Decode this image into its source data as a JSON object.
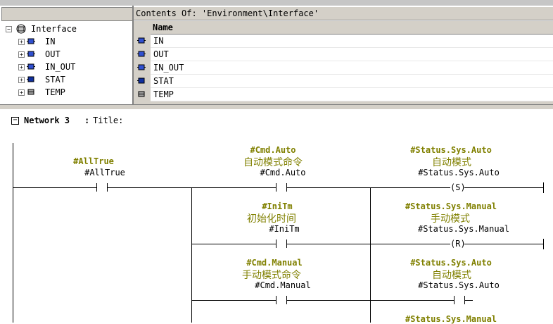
{
  "tree": {
    "root_label": "Interface",
    "items": [
      {
        "label": "IN"
      },
      {
        "label": "OUT"
      },
      {
        "label": "IN_OUT"
      },
      {
        "label": "STAT"
      },
      {
        "label": "TEMP"
      }
    ]
  },
  "contents": {
    "title": "Contents Of: 'Environment\\Interface'",
    "column_name": "Name",
    "rows": [
      {
        "name": "IN"
      },
      {
        "name": "OUT"
      },
      {
        "name": "IN_OUT"
      },
      {
        "name": "STAT"
      },
      {
        "name": "TEMP"
      }
    ]
  },
  "network": {
    "label": "Network 3",
    "sep": ":",
    "title": "Title:",
    "elements": [
      {
        "sym": "#AllTrue",
        "cn": "",
        "addr": "#AllTrue",
        "kind": "contact"
      },
      {
        "sym": "#Cmd.Auto",
        "cn": "自动模式命令",
        "addr": "#Cmd.Auto",
        "kind": "contact"
      },
      {
        "sym": "#Status.Sys.Auto",
        "cn": "自动模式",
        "addr": "#Status.Sys.Auto",
        "kind": "coil",
        "coil": "S"
      },
      {
        "sym": "#IniTm",
        "cn": "初始化时间",
        "addr": "#IniTm",
        "kind": "contact"
      },
      {
        "sym": "#Status.Sys.Manual",
        "cn": "手动模式",
        "addr": "#Status.Sys.Manual",
        "kind": "coil",
        "coil": "R"
      },
      {
        "sym": "#Cmd.Manual",
        "cn": "手动模式命令",
        "addr": "#Cmd.Manual",
        "kind": "contact"
      },
      {
        "sym": "#Status.Sys.Auto",
        "cn": "自动模式",
        "addr": "#Status.Sys.Auto",
        "kind": "contact"
      },
      {
        "sym": "#Status.Sys.Manual",
        "cn": "",
        "addr": "",
        "kind": "coil"
      }
    ]
  }
}
